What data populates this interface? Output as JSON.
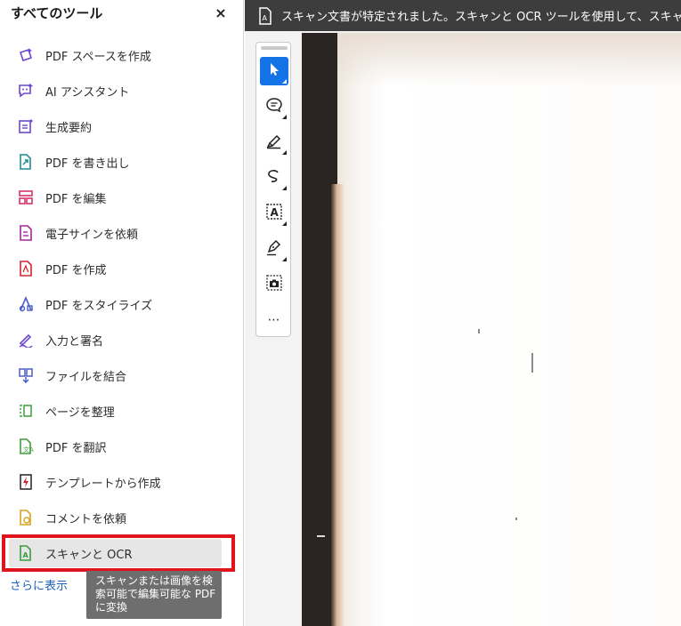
{
  "panel": {
    "title": "すべてのツール",
    "close_label": "×",
    "more_link": "さらに表示",
    "tooltip": "スキャンまたは画像を検索可能で編集可能な PDF に変換",
    "tools": [
      {
        "label": "PDF スペースを作成",
        "icon": "pdf-space-icon",
        "color": "#6e45d6"
      },
      {
        "label": "AI アシスタント",
        "icon": "ai-assistant-icon",
        "color": "#6e45d6"
      },
      {
        "label": "生成要約",
        "icon": "generative-summary-icon",
        "color": "#6e45d6"
      },
      {
        "label": "PDF を書き出し",
        "icon": "export-pdf-icon",
        "color": "#1f8e92"
      },
      {
        "label": "PDF を編集",
        "icon": "edit-pdf-icon",
        "color": "#d6336c"
      },
      {
        "label": "電子サインを依頼",
        "icon": "request-esign-icon",
        "color": "#a5269b"
      },
      {
        "label": "PDF を作成",
        "icon": "create-pdf-icon",
        "color": "#d4262d"
      },
      {
        "label": "PDF をスタイライズ",
        "icon": "stylize-pdf-icon",
        "color": "#4a5dc8"
      },
      {
        "label": "入力と署名",
        "icon": "fill-sign-icon",
        "color": "#6e45d6"
      },
      {
        "label": "ファイルを結合",
        "icon": "combine-files-icon",
        "color": "#4a5dc8"
      },
      {
        "label": "ページを整理",
        "icon": "organize-pages-icon",
        "color": "#3d9c3d"
      },
      {
        "label": "PDF を翻訳",
        "icon": "translate-pdf-icon",
        "color": "#3d9c3d"
      },
      {
        "label": "テンプレートから作成",
        "icon": "template-icon",
        "color": "#d4262d"
      },
      {
        "label": "コメントを依頼",
        "icon": "request-comments-icon",
        "color": "#d9a21b"
      },
      {
        "label": "スキャンと OCR",
        "icon": "scan-ocr-icon",
        "color": "#3d9c3d"
      }
    ]
  },
  "notice": {
    "text": "スキャン文書が特定されました。スキャンと OCR ツールを使用して、スキャンまたは画",
    "icon": "scanned-document-icon"
  },
  "toolbar": {
    "tools": [
      {
        "name": "select-tool",
        "icon": "pointer-icon",
        "active": true
      },
      {
        "name": "comment-tool",
        "icon": "comment-bubble-icon",
        "active": false
      },
      {
        "name": "highlight-tool",
        "icon": "highlighter-icon",
        "active": false
      },
      {
        "name": "draw-tool",
        "icon": "freehand-draw-icon",
        "active": false
      },
      {
        "name": "text-recognition-tool",
        "icon": "text-select-box-icon",
        "active": false
      },
      {
        "name": "fill-sign-tool",
        "icon": "pen-sign-icon",
        "active": false
      },
      {
        "name": "snapshot-tool",
        "icon": "camera-snapshot-icon",
        "active": false
      },
      {
        "name": "more-tools",
        "icon": "more-dots-icon",
        "active": false
      }
    ],
    "more_label": "⋯"
  },
  "colors": {
    "accent": "#1473e6",
    "highlight_border": "#e1141b",
    "notice_bg": "#3d3d3d",
    "link": "#1e5eb8"
  }
}
